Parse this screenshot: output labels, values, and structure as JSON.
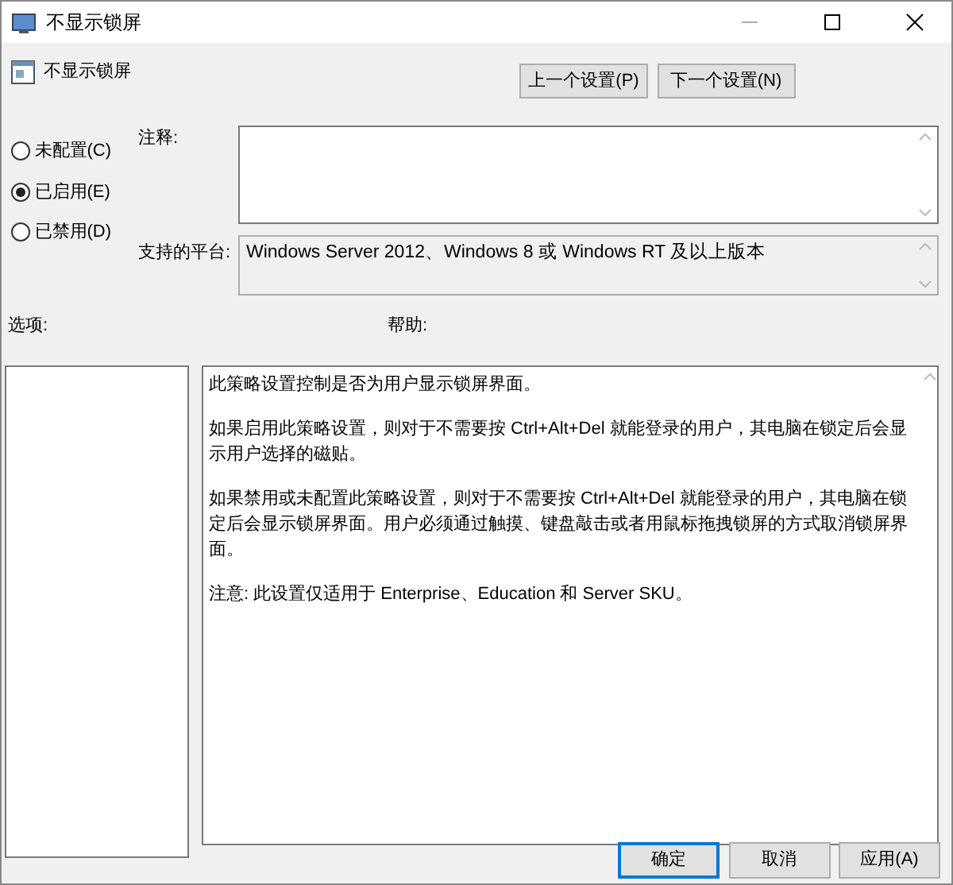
{
  "window": {
    "title": "不显示锁屏"
  },
  "policy": {
    "title": "不显示锁屏"
  },
  "nav_buttons": [
    {
      "label": "上一个设置(P)"
    },
    {
      "label": "下一个设置(N)"
    }
  ],
  "radios": [
    {
      "label": "未配置(C)",
      "selected": false
    },
    {
      "label": "已启用(E)",
      "selected": true
    },
    {
      "label": "已禁用(D)",
      "selected": false
    }
  ],
  "comment": {
    "label": "注释:"
  },
  "platform": {
    "label": "支持的平台:",
    "value": "Windows Server 2012、Windows 8 或 Windows RT 及以上版本"
  },
  "options": {
    "label": "选项:"
  },
  "help": {
    "label": "帮助:",
    "paragraphs": [
      "此策略设置控制是否为用户显示锁屏界面。",
      "如果启用此策略设置，则对于不需要按 Ctrl+Alt+Del 就能登录的用户，其电脑在锁定后会显示用户选择的磁贴。",
      "如果禁用或未配置此策略设置，则对于不需要按 Ctrl+Alt+Del 就能登录的用户，其电脑在锁定后会显示锁屏界面。用户必须通过触摸、键盘敲击或者用鼠标拖拽锁屏的方式取消锁屏界面。",
      "注意: 此设置仅适用于 Enterprise、Education 和 Server SKU。"
    ]
  },
  "footer_buttons": [
    {
      "label": "确定",
      "selected": true
    },
    {
      "label": "取消",
      "selected": false
    },
    {
      "label": "应用(A)",
      "selected": false
    }
  ]
}
